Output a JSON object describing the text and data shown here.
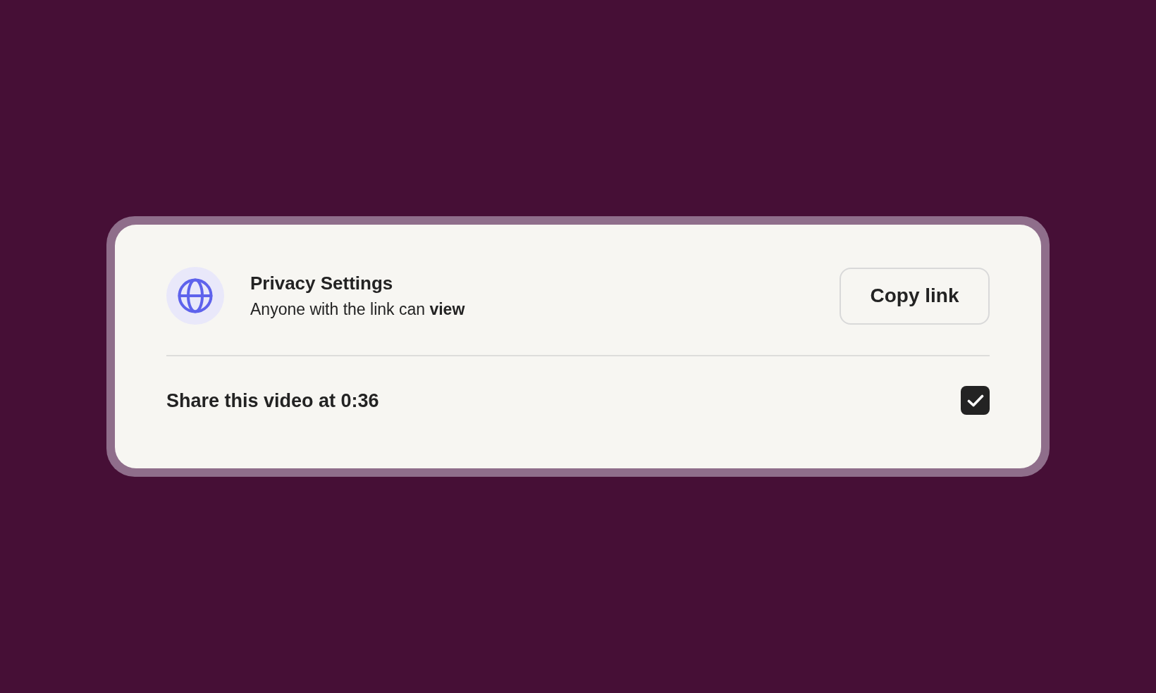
{
  "privacy": {
    "title": "Privacy Settings",
    "description": "Anyone with the link can **view**"
  },
  "copy_button": {
    "label": "Copy link"
  },
  "share_option": {
    "label": "Share this video at 0:36",
    "checked": true
  }
}
